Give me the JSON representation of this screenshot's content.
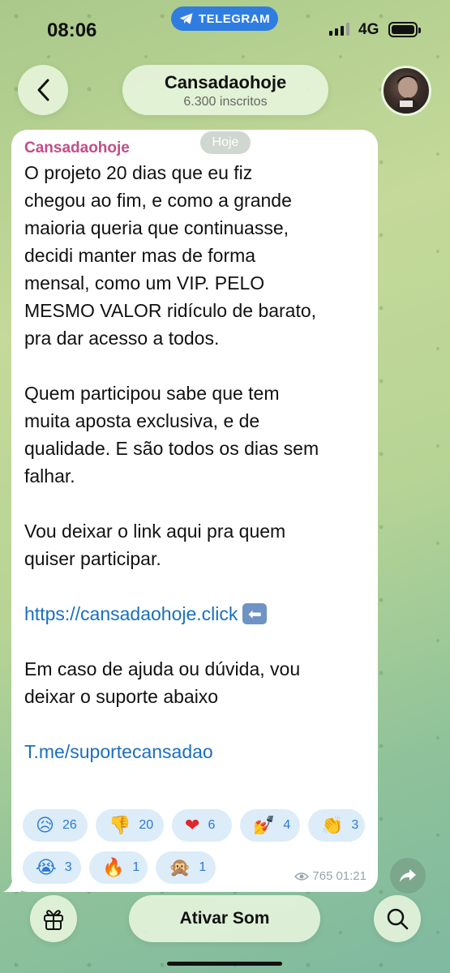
{
  "status_bar": {
    "time": "08:06",
    "telegram_label": "TELEGRAM",
    "network": "4G"
  },
  "header": {
    "channel_name": "Cansadaohoje",
    "subscribers": "6.300 inscritos",
    "date_chip": "Hoje"
  },
  "message": {
    "sender": "Cansadaohoje",
    "paragraphs": {
      "p1": "O projeto 20 dias que eu fiz\nchegou ao fim, e como a grande\nmaioria queria que continuasse,\ndecidi manter mas de forma\nmensal, como um VIP. PELO\nMESMO VALOR ridículo de barato,\npra dar acesso a todos.",
      "p2": "Quem participou sabe que tem\nmuita aposta exclusiva, e de\nqualidade. E são todos os dias sem\nfalhar.",
      "p3": "Vou deixar o link aqui pra quem\nquiser participar.",
      "link1": "https://cansadaohoje.click",
      "p4": "Em caso de ajuda ou dúvida, vou\ndeixar o suporte abaixo",
      "link2": "T.me/suportecansadao"
    },
    "reactions": [
      {
        "emoji": "😥",
        "count": "26"
      },
      {
        "emoji": "👎",
        "count": "20"
      },
      {
        "emoji": "❤",
        "count": "6"
      },
      {
        "emoji": "💅",
        "count": "4"
      },
      {
        "emoji": "👏",
        "count": "3"
      },
      {
        "emoji": "😭",
        "count": "3"
      },
      {
        "emoji": "🔥",
        "count": "1"
      },
      {
        "emoji": "🙊",
        "count": "1"
      }
    ],
    "views": "765",
    "time": "01:21"
  },
  "bottom_bar": {
    "sound_label": "Ativar Som"
  },
  "colors": {
    "accent": "#2f7de1",
    "sender": "#c24c8a",
    "link": "#1a6fbf",
    "reaction_bg": "#dcecf8"
  }
}
